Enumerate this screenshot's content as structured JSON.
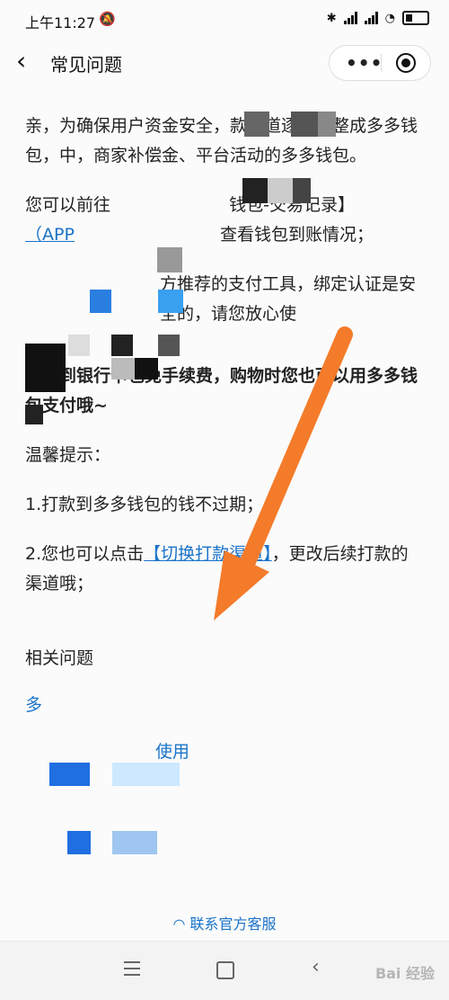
{
  "status_bar": {
    "time": "上午11:27",
    "mute_icon": "mute-icon"
  },
  "header": {
    "title": "常见问题",
    "back_icon": "chevron-left-icon"
  },
  "content": {
    "p1": "亲，为确保用户资金安全，款渠道逐步调整成多多钱包，中，商家补偿金、平台活动的多多钱包。",
    "p2_a": "您可以前往",
    "p2_b": "钱包-交易记录】",
    "p2_app": "（APP",
    "p2_c": "查看钱包到账情况；",
    "p3": "方推荐的支付工具，绑定认证是安全的，请您放心使",
    "bold": "提现到银行卡也免手续费，购物时您也可以用多多钱包支付哦~",
    "tip_title": "温馨提示：",
    "tip1": "1.打款到多多钱包的钱不过期；",
    "tip2_a": "2.您也可以点击",
    "tip2_link": "【切换打款渠道】",
    "tip2_b": "，更改后续打款的渠道哦；",
    "related_title": "相关问题",
    "related_1": "多",
    "related_2": "使用"
  },
  "contact": {
    "label": "联系官方客服",
    "icon": "headset-icon"
  },
  "watermark": "Bai 经验"
}
